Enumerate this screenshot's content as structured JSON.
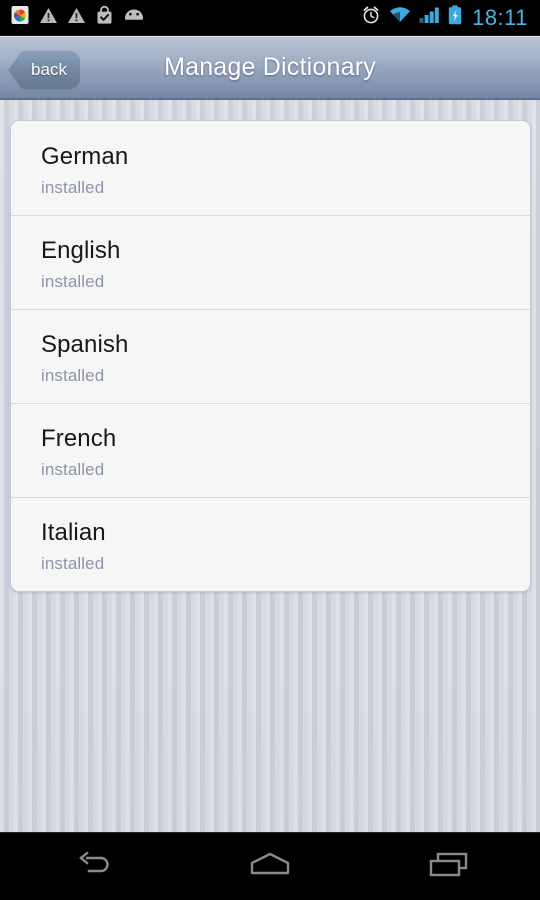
{
  "status_bar": {
    "time": "18:11",
    "time_color": "#4cb2e0",
    "background": "#000000",
    "left_icons": [
      {
        "name": "photos-app-icon",
        "label": "photos"
      },
      {
        "name": "warning-triangle-icon",
        "label": "warning"
      },
      {
        "name": "warning-triangle-icon",
        "label": "warning"
      },
      {
        "name": "play-store-bag-check-icon",
        "label": "app installed"
      },
      {
        "name": "android-head-icon",
        "label": "android"
      }
    ],
    "right_icons": [
      {
        "name": "alarm-clock-icon",
        "label": "alarm"
      },
      {
        "name": "wifi-icon",
        "label": "wifi"
      },
      {
        "name": "cellular-signal-icon",
        "label": "signal"
      },
      {
        "name": "battery-charging-icon",
        "label": "charging"
      }
    ]
  },
  "title_bar": {
    "title": "Manage Dictionary",
    "back_label": "back",
    "gradient_top": "#b9c3d3",
    "gradient_bottom": "#74879f",
    "title_color": "#ffffff"
  },
  "dictionary_list": {
    "items": [
      {
        "language": "German",
        "status": "installed"
      },
      {
        "language": "English",
        "status": "installed"
      },
      {
        "language": "Spanish",
        "status": "installed"
      },
      {
        "language": "French",
        "status": "installed"
      },
      {
        "language": "Italian",
        "status": "installed"
      }
    ],
    "card_background": "#f6f6f7",
    "title_color": "#16181c",
    "status_color": "#8d95a8",
    "divider_color": "#d6dae1"
  },
  "nav_bar": {
    "background": "#000000",
    "icon_color": "#8a8a8a",
    "buttons": [
      {
        "name": "nav-back-button",
        "label": "Back"
      },
      {
        "name": "nav-home-button",
        "label": "Home"
      },
      {
        "name": "nav-recents-button",
        "label": "Recent apps"
      }
    ]
  },
  "background": {
    "color": "#ced3dc",
    "texture": "vertical-stripes"
  }
}
